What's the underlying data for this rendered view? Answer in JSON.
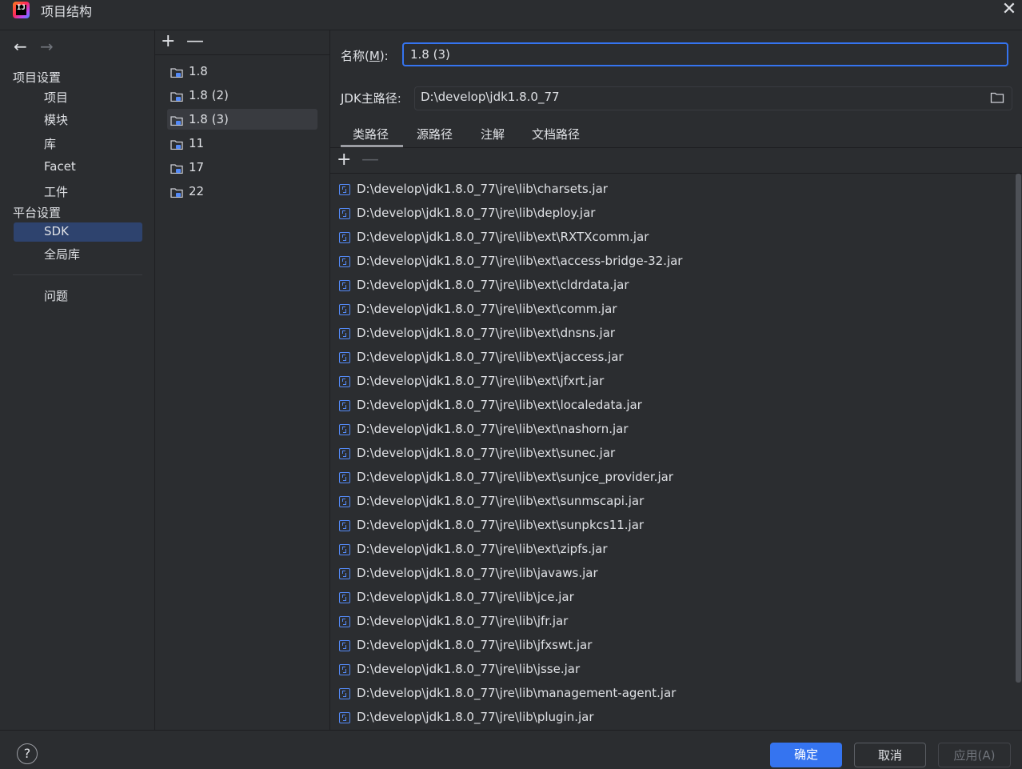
{
  "window": {
    "title": "项目结构"
  },
  "nav": {
    "back_icon": "←",
    "forward_icon": "→",
    "project_settings_header": "项目设置",
    "project_items": [
      "项目",
      "模块",
      "库",
      "Facet",
      "工件"
    ],
    "platform_settings_header": "平台设置",
    "platform_items": [
      "SDK",
      "全局库"
    ],
    "selected": "SDK",
    "problems": "问题"
  },
  "sdk_list": {
    "add_icon": "+",
    "remove_icon": "—",
    "items": [
      "1.8",
      "1.8 (2)",
      "1.8 (3)",
      "11",
      "17",
      "22"
    ],
    "selected": "1.8 (3)"
  },
  "detail": {
    "name_label_prefix": "名称(",
    "name_label_mnemonic": "M",
    "name_label_suffix": "):",
    "name_value": "1.8 (3)",
    "jdk_home_label": "JDK主路径:",
    "jdk_home_value": "D:\\develop\\jdk1.8.0_77",
    "tabs": [
      "类路径",
      "源路径",
      "注解",
      "文档路径"
    ],
    "active_tab": "类路径",
    "classpath": [
      "D:\\develop\\jdk1.8.0_77\\jre\\lib\\charsets.jar",
      "D:\\develop\\jdk1.8.0_77\\jre\\lib\\deploy.jar",
      "D:\\develop\\jdk1.8.0_77\\jre\\lib\\ext\\RXTXcomm.jar",
      "D:\\develop\\jdk1.8.0_77\\jre\\lib\\ext\\access-bridge-32.jar",
      "D:\\develop\\jdk1.8.0_77\\jre\\lib\\ext\\cldrdata.jar",
      "D:\\develop\\jdk1.8.0_77\\jre\\lib\\ext\\comm.jar",
      "D:\\develop\\jdk1.8.0_77\\jre\\lib\\ext\\dnsns.jar",
      "D:\\develop\\jdk1.8.0_77\\jre\\lib\\ext\\jaccess.jar",
      "D:\\develop\\jdk1.8.0_77\\jre\\lib\\ext\\jfxrt.jar",
      "D:\\develop\\jdk1.8.0_77\\jre\\lib\\ext\\localedata.jar",
      "D:\\develop\\jdk1.8.0_77\\jre\\lib\\ext\\nashorn.jar",
      "D:\\develop\\jdk1.8.0_77\\jre\\lib\\ext\\sunec.jar",
      "D:\\develop\\jdk1.8.0_77\\jre\\lib\\ext\\sunjce_provider.jar",
      "D:\\develop\\jdk1.8.0_77\\jre\\lib\\ext\\sunmscapi.jar",
      "D:\\develop\\jdk1.8.0_77\\jre\\lib\\ext\\sunpkcs11.jar",
      "D:\\develop\\jdk1.8.0_77\\jre\\lib\\ext\\zipfs.jar",
      "D:\\develop\\jdk1.8.0_77\\jre\\lib\\javaws.jar",
      "D:\\develop\\jdk1.8.0_77\\jre\\lib\\jce.jar",
      "D:\\develop\\jdk1.8.0_77\\jre\\lib\\jfr.jar",
      "D:\\develop\\jdk1.8.0_77\\jre\\lib\\jfxswt.jar",
      "D:\\develop\\jdk1.8.0_77\\jre\\lib\\jsse.jar",
      "D:\\develop\\jdk1.8.0_77\\jre\\lib\\management-agent.jar",
      "D:\\develop\\jdk1.8.0_77\\jre\\lib\\plugin.jar"
    ]
  },
  "footer": {
    "help_icon": "?",
    "ok_label": "确定",
    "cancel_label": "取消",
    "apply_label": "应用(A)"
  },
  "colors": {
    "background": "#2b2d30",
    "accent": "#3574f0",
    "selection": "#2e436e",
    "text": "#dfe1e5"
  }
}
